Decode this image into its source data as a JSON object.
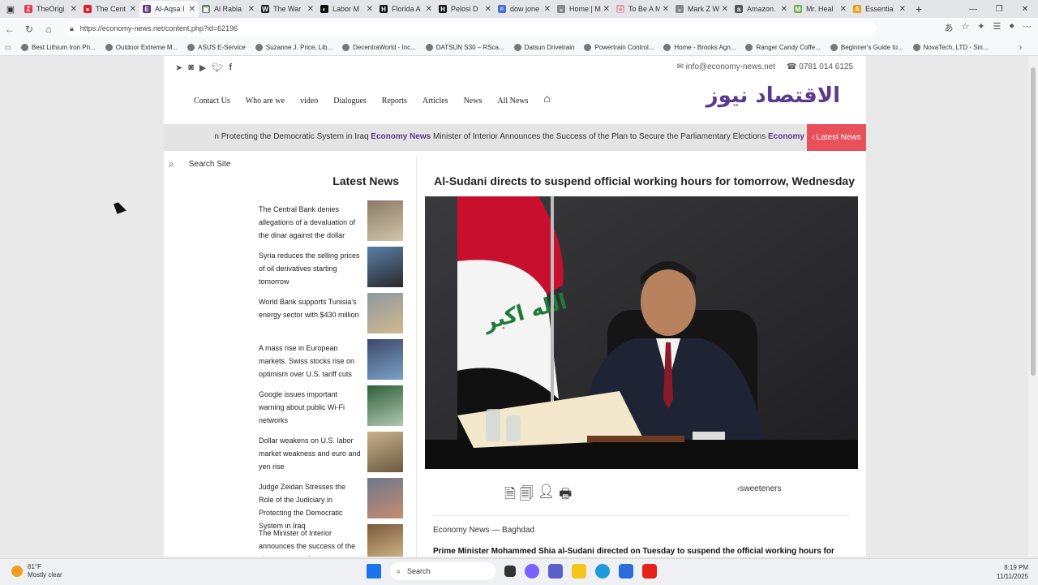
{
  "browser": {
    "tabs": [
      {
        "label": "TheOrigi",
        "color": "#e8384f",
        "glyph": "Z"
      },
      {
        "label": "The Cent",
        "color": "#e02030",
        "glyph": "●"
      },
      {
        "label": "Al-Aqsa I",
        "color": "#5b3a8e",
        "glyph": "E",
        "active": true
      },
      {
        "label": "Al Rabia",
        "color": "#6a7b6b",
        "glyph": "▣"
      },
      {
        "label": "The War",
        "color": "#222222",
        "glyph": "W"
      },
      {
        "label": "Labor M",
        "color": "#111111",
        "glyph": "◐"
      },
      {
        "label": "Florida A",
        "color": "#111111",
        "glyph": "H"
      },
      {
        "label": "Pelosi D",
        "color": "#111111",
        "glyph": "H"
      },
      {
        "label": "dow jone",
        "color": "#4b6fd8",
        "glyph": "⌕"
      },
      {
        "label": "Home | M",
        "color": "#888888",
        "glyph": "◒"
      },
      {
        "label": "To Be A M",
        "color": "#e0a0b0",
        "glyph": "▢"
      },
      {
        "label": "Mark Z W",
        "color": "#888888",
        "glyph": "◒"
      },
      {
        "label": "Amazon.",
        "color": "#555555",
        "glyph": "a"
      },
      {
        "label": "Mr. Heal",
        "color": "#7a5",
        "glyph": "M"
      },
      {
        "label": "Essentia",
        "color": "#f39c12",
        "glyph": "A"
      }
    ],
    "url": "https://economy-news.net/content.php?id=62196",
    "bookmarks": [
      "Best Lithium Iron Ph...",
      "Outdoor Extreme M...",
      "ASUS E-Service",
      "Suzanne J. Price, Lib...",
      "DecentraWorld - Inc...",
      "DATSUN S30 – RSca...",
      "Datsun Drivetrain",
      "Powertrain Control...",
      "Home - Brooks Agn...",
      "Ranger Candy Coffe...",
      "Beginner's Guide to...",
      "NovaTech, LTD - Sin..."
    ]
  },
  "site": {
    "email": "info@economy-news.net",
    "phone": "0781 014 6125",
    "logo": "الاقتصاد نيوز",
    "menu": [
      "Contact Us",
      "Who are we",
      "video",
      "Dialogues",
      "Reports",
      "Articles",
      "News",
      "All News"
    ],
    "ticker": {
      "text1": "n Protecting the Democratic System in Iraq",
      "brand1": "Economy News",
      "text2": "Minister of Interior Announces the Success of the Plan to Secure the Parliamentary Elections",
      "brand2": "Economy",
      "tag": "Latest News"
    },
    "search_placeholder": "Search Site",
    "latest_heading": "Latest News",
    "latest": [
      "The Central Bank denies allegations of a devaluation of the dinar against the dollar",
      "Syria reduces the selling prices of oil derivatives starting tomorrow",
      "World Bank supports Tunisia's energy sector with $430 million",
      "A mass rise in European markets. Swiss stocks rise on optimism over U.S. tariff cuts",
      "Google issues important warning about public Wi-Fi networks",
      "Dollar weakens on U.S. labor market weakness and euro and yen rise",
      "Judge Zeidan Stresses the Role of the Judiciary in Protecting the Democratic System in Iraq",
      "The Minister of Interior announces the success of the plan to secure the parliamentary"
    ],
    "article": {
      "headline": "Al-Sudani directs to suspend official working hours for tomorrow, Wednesday",
      "sweeteners": "sweeteners",
      "dateline": "Economy News — Baghdad",
      "lede": "Prime Minister Mohammed Shia al-Sudani directed on Tuesday to suspend the official working hours for"
    }
  },
  "taskbar": {
    "temp": "81°F",
    "weather": "Mostly clear",
    "search": "Search",
    "time": "8:19 PM",
    "date": "11/11/2025"
  }
}
